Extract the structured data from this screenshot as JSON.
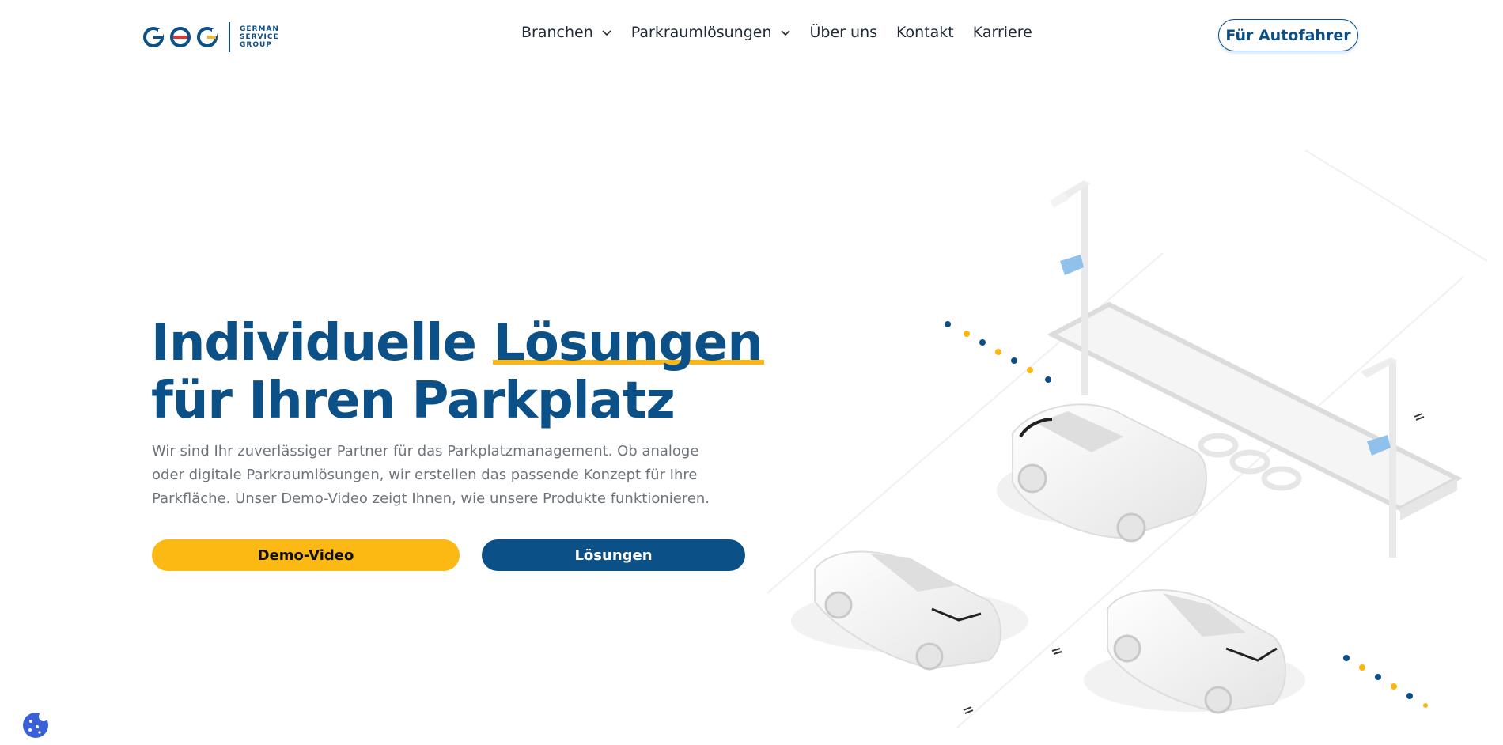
{
  "brand": {
    "name_lines": [
      "GERMAN",
      "SERVICE",
      "GROUP"
    ],
    "letters": [
      "G",
      "S",
      "G"
    ],
    "colors": {
      "primary": "#0c5088",
      "accent": "#fbb614",
      "red": "#e3342f"
    }
  },
  "nav": {
    "items": [
      {
        "label": "Branchen",
        "dropdown": true
      },
      {
        "label": "Parkraumlösungen",
        "dropdown": true
      },
      {
        "label": "Über uns",
        "dropdown": false
      },
      {
        "label": "Kontakt",
        "dropdown": false
      },
      {
        "label": "Karriere",
        "dropdown": false
      }
    ],
    "cta_label": "Für Autofahrer"
  },
  "hero": {
    "title_part1": "Individuelle ",
    "title_highlight": "Lösungen",
    "title_line2": "für Ihren Parkplatz",
    "description": "Wir sind Ihr zuverlässiger Partner für das Parkplatzmanagement. Ob analoge oder digitale Parkraumlösungen, wir erstellen das passende Konzept für Ihre Parkfläche. Unser Demo-Video zeigt Ihnen, wie unsere Produkte funktionieren.",
    "primary_button": "Demo-Video",
    "secondary_button": "Lösungen"
  },
  "icons": {
    "chevron": "chevron-down-icon",
    "cookie": "cookie-icon"
  }
}
